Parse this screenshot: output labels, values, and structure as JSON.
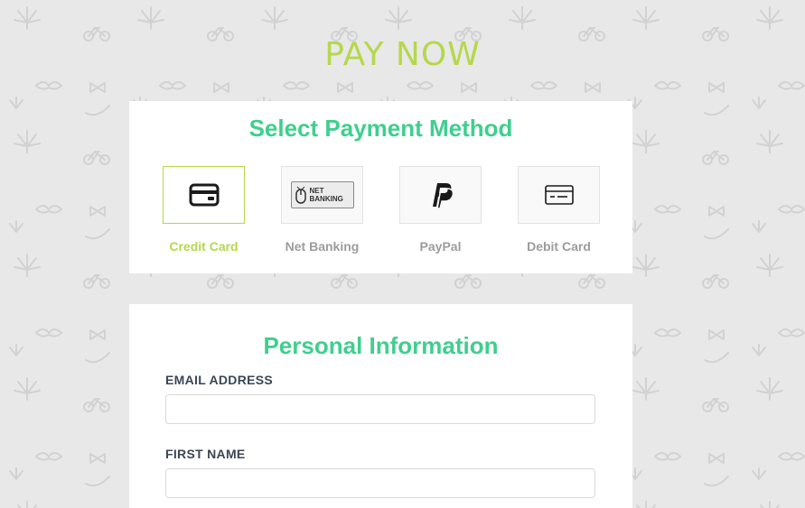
{
  "page": {
    "title": "PAY NOW"
  },
  "payment": {
    "heading": "Select Payment Method",
    "net_banking_logo_text": "NET\nBANKING",
    "methods": [
      {
        "id": "credit-card",
        "label": "Credit Card",
        "icon": "credit-card-icon",
        "selected": true
      },
      {
        "id": "net-banking",
        "label": "Net Banking",
        "icon": "net-banking-icon",
        "selected": false
      },
      {
        "id": "paypal",
        "label": "PayPal",
        "icon": "paypal-icon",
        "selected": false
      },
      {
        "id": "debit-card",
        "label": "Debit Card",
        "icon": "debit-card-icon",
        "selected": false
      }
    ]
  },
  "personal": {
    "heading": "Personal Information",
    "fields": [
      {
        "label": "EMAIL ADDRESS",
        "value": "",
        "placeholder": ""
      },
      {
        "label": "FIRST NAME",
        "value": "",
        "placeholder": ""
      }
    ]
  },
  "colors": {
    "accent_green": "#3fcf8e",
    "lime": "#b5d84a",
    "background": "#e8e8e8"
  }
}
